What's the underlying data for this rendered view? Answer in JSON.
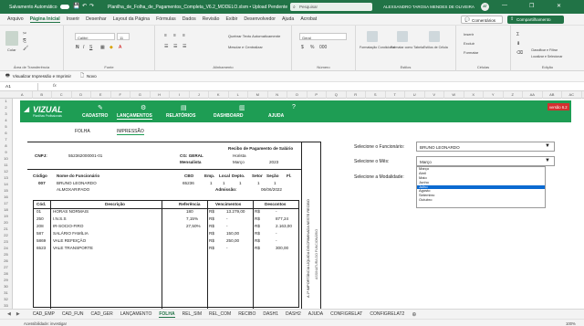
{
  "titlebar": {
    "autosave": "Salvamento Automático",
    "filename": "Planilha_de_Folha_de_Pagamentos_Completa_V6.2_MODELO.xlsm • Upload Pendente",
    "search": "Pesquisar",
    "user": "ALEXSANDRO TAROSA MENDES DE OLIVEIRA",
    "user_initials": "AT"
  },
  "menu": [
    "Arquivo",
    "Página Inicial",
    "Inserir",
    "Desenhar",
    "Layout da Página",
    "Fórmulas",
    "Dados",
    "Revisão",
    "Exibir",
    "Desenvolvedor",
    "Ajuda",
    "Acrobat"
  ],
  "menu_active": 1,
  "comments_label": "Comentários",
  "share_label": "Compartilhamento",
  "ribbon": {
    "clipboard": "Área de Transferência",
    "paste": "Colar",
    "font_name": "Calibri",
    "font_size": "11",
    "font_group": "Fonte",
    "wrap": "Quebrar Texto Automaticamente",
    "merge": "Mesclar e Centralizar",
    "align_group": "Alinhamento",
    "number_format": "Geral",
    "number_group": "Número",
    "cond_format": "Formatação Condicional",
    "format_table": "Formatar como Tabela",
    "cell_styles": "Estilos de Célula",
    "styles_group": "Estilos",
    "insert": "Inserir",
    "delete": "Excluir",
    "format": "Formatar",
    "cells_group": "Células",
    "edit_group": "Edição",
    "ideas": "Classificar e Filtrar",
    "find": "Localizar e Selecionar",
    "sensitivity": "Sensibilidade"
  },
  "quickbar": {
    "print_preview": "Visualizar Impressão e Imprimir",
    "new": "Novo"
  },
  "formula_bar": {
    "cell_ref": "A1",
    "fx": "fx"
  },
  "columns": [
    "A",
    "B",
    "C",
    "D",
    "E",
    "F",
    "G",
    "H",
    "I",
    "J",
    "K",
    "L",
    "M",
    "N",
    "O",
    "P",
    "Q",
    "R",
    "S",
    "T",
    "U",
    "V",
    "W",
    "X",
    "Y",
    "Z",
    "AA",
    "AB",
    "AC"
  ],
  "rows": [
    "1",
    "2",
    "3",
    "4",
    "5",
    "6",
    "7",
    "8",
    "9",
    "10",
    "11",
    "12",
    "13",
    "14",
    "15",
    "16",
    "17",
    "18",
    "19",
    "20",
    "21",
    "22",
    "23",
    "24",
    "25",
    "26",
    "27",
    "28",
    "29",
    "30",
    "31",
    "32",
    "33"
  ],
  "app": {
    "logo": "VIZUAL",
    "logo_sub": "Planilhas Profissionais",
    "nav": [
      "CADASTRO",
      "LANÇAMENTOS",
      "RELATÓRIOS",
      "DASHBOARD",
      "AJUDA"
    ],
    "nav_active": 1,
    "version": "versão 6.2",
    "subnav": [
      "FOLHA",
      "IMPRESSÃO"
    ],
    "subnav_active": 1
  },
  "receipt": {
    "title": "Recibo de Pagamento de Salário",
    "cnpj_label": "CNPJ:",
    "cnpj": "552362000001-01",
    "cg_label": "CG: GERAL",
    "company": "Horista",
    "type": "Mensalista",
    "month": "Março",
    "year": "2023",
    "head_code": "Código",
    "head_name": "Nome do Funcionário",
    "head_cbo": "CBO",
    "head_emp": "Emp.",
    "head_local": "Local",
    "head_depto": "Depto.",
    "head_setor": "Setor",
    "head_secao": "Seção",
    "head_fl": "Fl.",
    "emp_code": "007",
    "emp_name": "BRUNO LEONARDO",
    "emp_cbo": "65236",
    "emp_nums": [
      "1",
      "1",
      "1",
      "1",
      "1"
    ],
    "emp_role": "ALMOXARIFADO",
    "admission_label": "Admissão:",
    "admission": "06/06/2022",
    "col_cod": "Cód.",
    "col_desc": "Descrição",
    "col_ref": "Referência",
    "col_venc": "Vencimentos",
    "col_desc2": "Descontos",
    "lines": [
      {
        "cod": "01",
        "desc": "HORAS NORMAIS",
        "ref": "180",
        "v_cur": "R$",
        "v": "13.279,00",
        "d_cur": "R$",
        "d": "-"
      },
      {
        "cod": "250",
        "desc": "I.N.S.S",
        "ref": "7,15%",
        "v_cur": "R$",
        "v": "-",
        "d_cur": "R$",
        "d": "877,24"
      },
      {
        "cod": "208",
        "desc": "IR-SOCIO-FIRO",
        "ref": "27,50%",
        "v_cur": "R$",
        "v": "-",
        "d_cur": "R$",
        "d": "2.163,00"
      },
      {
        "cod": "587",
        "desc": "SALÁRIO FAMÍLIA",
        "ref": "",
        "v_cur": "R$",
        "v": "150,00",
        "d_cur": "R$",
        "d": "-"
      },
      {
        "cod": "5869",
        "desc": "VALE REFEIÇÃO",
        "ref": "",
        "v_cur": "R$",
        "v": "250,00",
        "d_cur": "R$",
        "d": "-"
      },
      {
        "cod": "6523",
        "desc": "VALE TRANSPORTE",
        "ref": "",
        "v_cur": "R$",
        "v": "-",
        "d_cur": "R$",
        "d": "300,00"
      }
    ],
    "side_text": "A 1ª IMPORTÂNCIA LÍQUIDA DISCRIMINADA NESTE RECIBO",
    "side_sign": "ASSINATURA DO FUNCIONÁRIO"
  },
  "panel": {
    "employee_label": "Selecione o Funcionário:",
    "employee_value": "BRUNO LEONARDO",
    "month_label": "Selecione o Mês:",
    "month_value": "Março",
    "mode_label": "Selecione a Modalidade:",
    "months": [
      "Março",
      "Abril",
      "Maio",
      "Junho",
      "Julho",
      "Agosto",
      "Setembro",
      "Outubro"
    ],
    "selected_index": 4
  },
  "sheet_tabs": [
    "CAD_EMP",
    "CAD_FUN",
    "CAD_GER",
    "LANÇAMENTO",
    "FOLHA",
    "REL_SIM",
    "REL_COM",
    "RECIBO",
    "DASH1",
    "DASH2",
    "AJUDA",
    "CONFIGRELAT",
    "CONFIGRELAT2"
  ],
  "sheet_active": 4,
  "status": {
    "accessibility": "Acessibilidade: investigar",
    "zoom": "100%"
  },
  "colors": {
    "excel_green": "#217346",
    "nav_green": "#1e9d54",
    "version_red": "#d32f2f",
    "select_blue": "#0b6ad1"
  }
}
